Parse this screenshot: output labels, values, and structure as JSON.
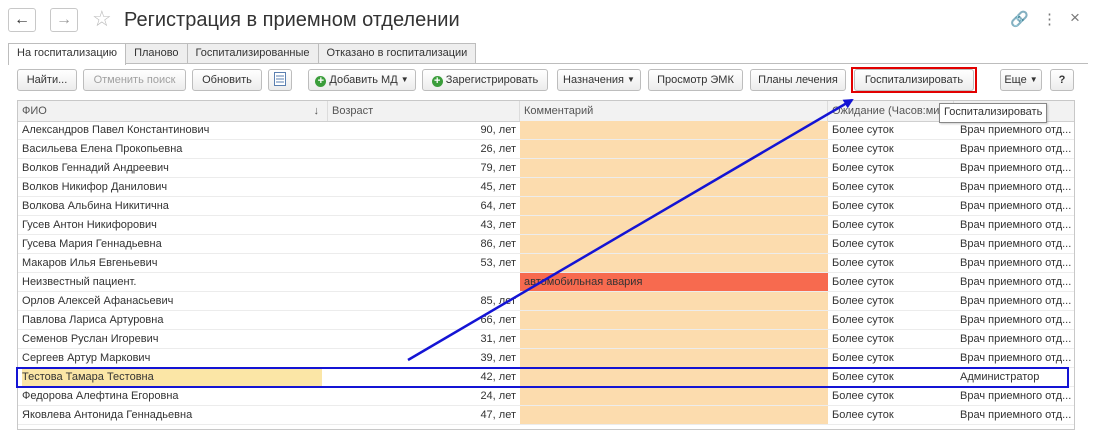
{
  "window": {
    "title": "Регистрация в приемном отделении",
    "back_icon": "←",
    "forward_icon": "→",
    "star_icon": "☆",
    "link_icon": "🔗",
    "more_icon": "⋮",
    "close_icon": "×"
  },
  "tabs": [
    "На госпитализацию",
    "Планово",
    "Госпитализированные",
    "Отказано в госпитализации"
  ],
  "toolbar": {
    "find": "Найти...",
    "cancel_search": "Отменить поиск",
    "refresh": "Обновить",
    "add_md": "Добавить МД",
    "register": "Зарегистрировать",
    "appointments": "Назначения",
    "view_emk": "Просмотр ЭМК",
    "treatment_plans": "Планы лечения",
    "hospitalize": "Госпитализировать",
    "more": "Еще",
    "help": "?"
  },
  "tooltip": "Госпитализировать",
  "columns": {
    "name": "ФИО",
    "sort_icon": "↓",
    "age": "Возраст",
    "comment": "Комментарий",
    "wait": "Ожидание (Часов:ми"
  },
  "rows": [
    {
      "name": "Александров Павел Константинович",
      "age": "90, лет",
      "comment": "",
      "wait": "Более суток",
      "who": "Врач приемного отд..."
    },
    {
      "name": "Васильева Елена Прокопьевна",
      "age": "26, лет",
      "comment": "",
      "wait": "Более суток",
      "who": "Врач приемного отд..."
    },
    {
      "name": "Волков Геннадий Андреевич",
      "age": "79, лет",
      "comment": "",
      "wait": "Более суток",
      "who": "Врач приемного отд..."
    },
    {
      "name": "Волков Никифор Данилович",
      "age": "45, лет",
      "comment": "",
      "wait": "Более суток",
      "who": "Врач приемного отд..."
    },
    {
      "name": "Волкова Альбина Никитична",
      "age": "64, лет",
      "comment": "",
      "wait": "Более суток",
      "who": "Врач приемного отд..."
    },
    {
      "name": "Гусев Антон Никифорович",
      "age": "43, лет",
      "comment": "",
      "wait": "Более суток",
      "who": "Врач приемного отд..."
    },
    {
      "name": "Гусева Мария Геннадьевна",
      "age": "86, лет",
      "comment": "",
      "wait": "Более суток",
      "who": "Врач приемного отд..."
    },
    {
      "name": "Макаров Илья Евгеньевич",
      "age": "53, лет",
      "comment": "",
      "wait": "Более суток",
      "who": "Врач приемного отд..."
    },
    {
      "name": "Неизвестный пациент.",
      "age": "",
      "comment": "автомобильная авария",
      "wait": "Более суток",
      "who": "Врач приемного отд..."
    },
    {
      "name": "Орлов Алексей Афанасьевич",
      "age": "85, лет",
      "comment": "",
      "wait": "Более суток",
      "who": "Врач приемного отд..."
    },
    {
      "name": "Павлова Лариса Артуровна",
      "age": "66, лет",
      "comment": "",
      "wait": "Более суток",
      "who": "Врач приемного отд..."
    },
    {
      "name": "Семенов Руслан Игоревич",
      "age": "31, лет",
      "comment": "",
      "wait": "Более суток",
      "who": "Врач приемного отд..."
    },
    {
      "name": "Сергеев Артур Маркович",
      "age": "39, лет",
      "comment": "",
      "wait": "Более суток",
      "who": "Врач приемного отд..."
    },
    {
      "name": "Тестова Тамара Тестовна",
      "age": "42, лет",
      "comment": "",
      "wait": "Более суток",
      "who": "Администратор"
    },
    {
      "name": "Федорова Алефтина Егоровна",
      "age": "24, лет",
      "comment": "",
      "wait": "Более суток",
      "who": "Врач приемного отд..."
    },
    {
      "name": "Яковлева Антонида Геннадьевна",
      "age": "47, лет",
      "comment": "",
      "wait": "Более суток",
      "who": "Врач приемного отд..."
    }
  ],
  "colors": {
    "comment_bg": "#fcdcae",
    "alert_bg": "#f76a4f",
    "highlight_red": "#e20000",
    "annotation_blue": "#1414d4"
  }
}
